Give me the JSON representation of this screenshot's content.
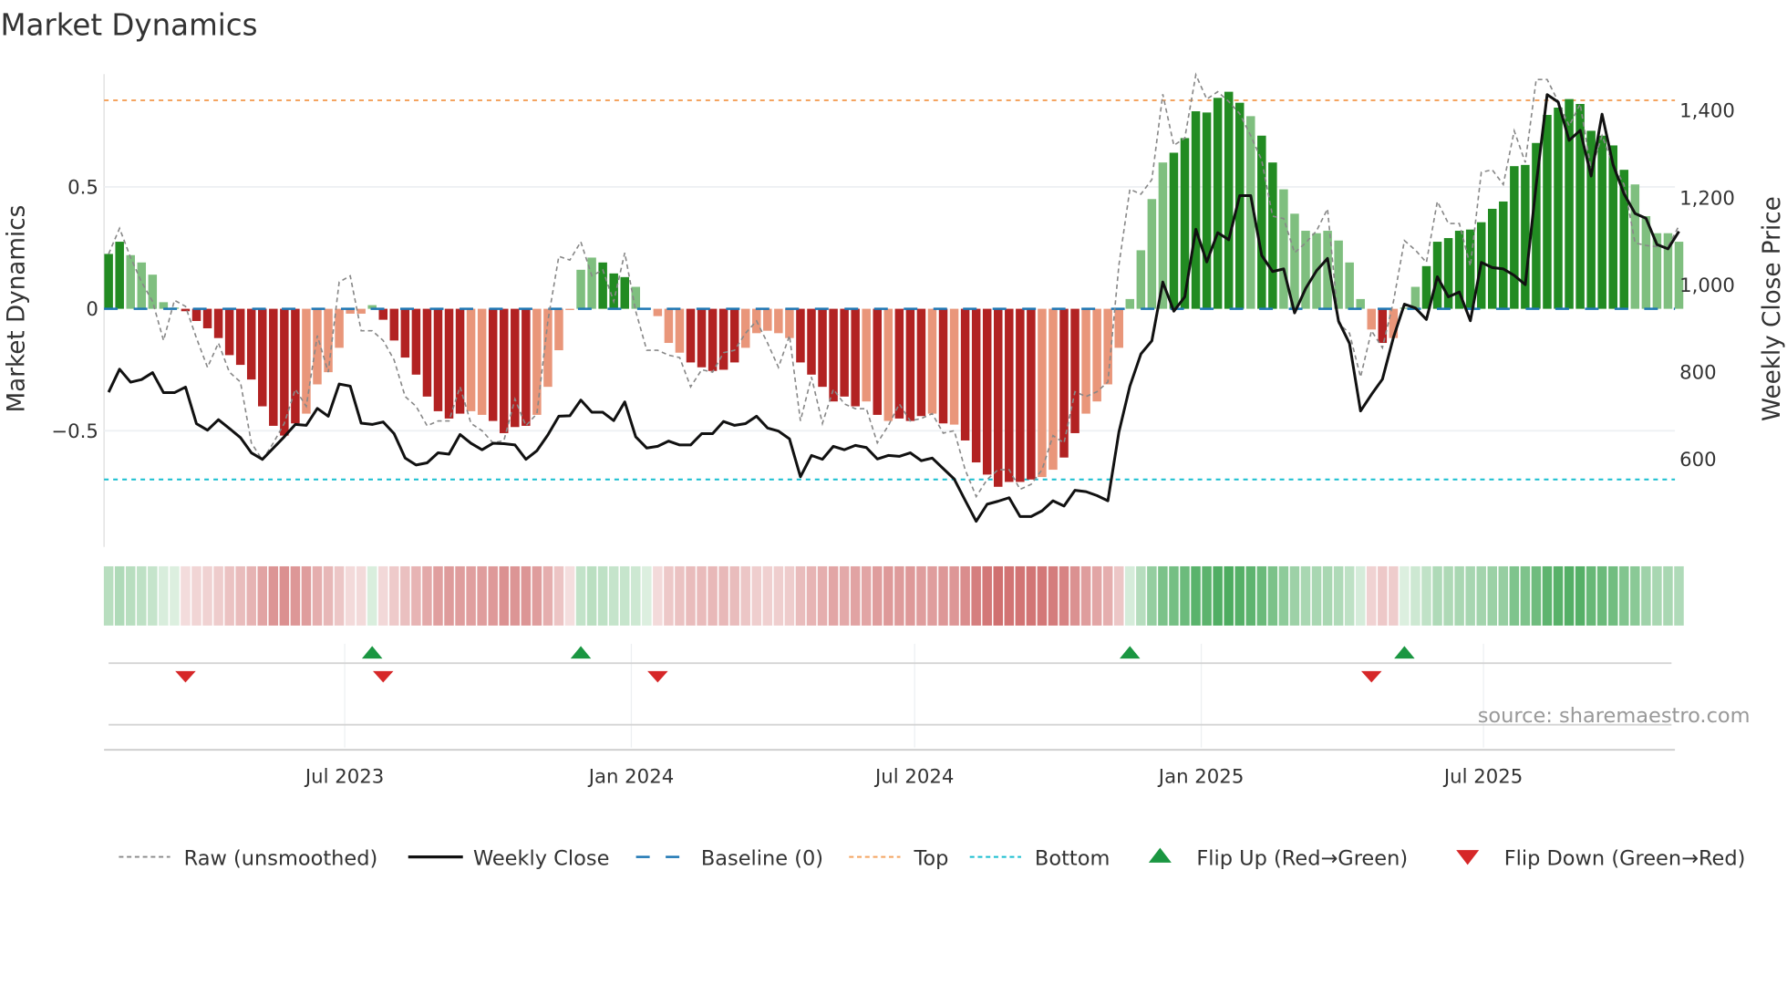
{
  "chart_data": {
    "type": "bar",
    "title": "Market Dynamics",
    "ylabel": "Market Dynamics",
    "y2label": "Weekly Close Price",
    "source": "source: sharemaestro.com",
    "ylim": [
      -0.98,
      0.96
    ],
    "y2lim": [
      420,
      1485
    ],
    "yticks": [
      {
        "v": 0.5,
        "label": "0.5"
      },
      {
        "v": 0,
        "label": "0"
      },
      {
        "v": -0.5,
        "label": "−0.5"
      }
    ],
    "y2ticks": [
      {
        "v": 1400,
        "label": "1,400"
      },
      {
        "v": 1200,
        "label": "1,200"
      },
      {
        "v": 1000,
        "label": "1,000"
      },
      {
        "v": 800,
        "label": "800"
      },
      {
        "v": 600,
        "label": "600"
      }
    ],
    "xticks": [
      {
        "week": 21.5,
        "label": "Jul 2023"
      },
      {
        "week": 47.6,
        "label": "Jan 2024"
      },
      {
        "week": 73.4,
        "label": "Jul 2024"
      },
      {
        "week": 99.5,
        "label": "Jan 2025"
      },
      {
        "week": 125.2,
        "label": "Jul 2025"
      }
    ],
    "top_level": 0.855,
    "bottom_level": -0.7,
    "baseline": 0,
    "momentum": [
      0.225,
      0.275,
      0.22,
      0.19,
      0.14,
      0.027,
      0.005,
      -0.01,
      -0.05,
      -0.08,
      -0.12,
      -0.19,
      -0.23,
      -0.29,
      -0.4,
      -0.48,
      -0.52,
      -0.47,
      -0.43,
      -0.31,
      -0.26,
      -0.16,
      -0.02,
      -0.02,
      0.015,
      -0.045,
      -0.13,
      -0.2,
      -0.27,
      -0.36,
      -0.42,
      -0.45,
      -0.43,
      -0.42,
      -0.435,
      -0.46,
      -0.51,
      -0.485,
      -0.48,
      -0.435,
      -0.32,
      -0.17,
      -0.005,
      0.16,
      0.21,
      0.19,
      0.145,
      0.13,
      0.09,
      0.003,
      -0.03,
      -0.14,
      -0.18,
      -0.22,
      -0.24,
      -0.255,
      -0.25,
      -0.22,
      -0.16,
      -0.1,
      -0.09,
      -0.1,
      -0.12,
      -0.22,
      -0.27,
      -0.32,
      -0.38,
      -0.36,
      -0.4,
      -0.38,
      -0.435,
      -0.46,
      -0.45,
      -0.46,
      -0.44,
      -0.43,
      -0.47,
      -0.475,
      -0.54,
      -0.63,
      -0.68,
      -0.73,
      -0.71,
      -0.71,
      -0.7,
      -0.69,
      -0.66,
      -0.61,
      -0.51,
      -0.43,
      -0.38,
      -0.31,
      -0.16,
      0.04,
      0.24,
      0.45,
      0.6,
      0.64,
      0.7,
      0.81,
      0.805,
      0.865,
      0.89,
      0.845,
      0.79,
      0.71,
      0.6,
      0.49,
      0.39,
      0.32,
      0.31,
      0.32,
      0.28,
      0.19,
      0.04,
      -0.085,
      -0.14,
      -0.12,
      0.005,
      0.09,
      0.175,
      0.275,
      0.29,
      0.32,
      0.325,
      0.355,
      0.41,
      0.44,
      0.585,
      0.59,
      0.68,
      0.795,
      0.825,
      0.86,
      0.84,
      0.73,
      0.71,
      0.67,
      0.57,
      0.51,
      0.38,
      0.31,
      0.31,
      0.275
    ],
    "bar_tone": "ddllllldddddddddddlllllllddddddddllddddlllllldddllllldddddlllllddddddldldddldldddddddllddlllllllldddddddlddllllllllldllldddgdddddddddddddddllllllllld",
    "raw": [
      0.225,
      0.33,
      0.21,
      0.11,
      0.03,
      -0.13,
      0.035,
      0.01,
      -0.12,
      -0.24,
      -0.14,
      -0.26,
      -0.3,
      -0.55,
      -0.62,
      -0.55,
      -0.47,
      -0.33,
      -0.4,
      -0.11,
      -0.26,
      0.11,
      0.135,
      -0.09,
      -0.09,
      -0.13,
      -0.21,
      -0.36,
      -0.4,
      -0.48,
      -0.46,
      -0.46,
      -0.32,
      -0.47,
      -0.5,
      -0.55,
      -0.54,
      -0.37,
      -0.48,
      -0.43,
      -0.05,
      0.215,
      0.2,
      0.275,
      0.135,
      0.16,
      0.03,
      0.23,
      -0.01,
      -0.17,
      -0.17,
      -0.19,
      -0.2,
      -0.32,
      -0.25,
      -0.26,
      -0.18,
      -0.17,
      -0.1,
      -0.05,
      -0.14,
      -0.24,
      -0.11,
      -0.46,
      -0.28,
      -0.47,
      -0.33,
      -0.39,
      -0.41,
      -0.41,
      -0.55,
      -0.48,
      -0.39,
      -0.46,
      -0.45,
      -0.43,
      -0.51,
      -0.5,
      -0.66,
      -0.77,
      -0.7,
      -0.66,
      -0.66,
      -0.74,
      -0.72,
      -0.66,
      -0.52,
      -0.55,
      -0.34,
      -0.36,
      -0.34,
      -0.3,
      0.18,
      0.49,
      0.47,
      0.53,
      0.88,
      0.67,
      0.7,
      0.96,
      0.86,
      0.89,
      0.85,
      0.8,
      0.71,
      0.61,
      0.38,
      0.37,
      0.23,
      0.27,
      0.32,
      0.41,
      -0.06,
      -0.1,
      -0.28,
      -0.09,
      -0.16,
      0.03,
      0.28,
      0.24,
      0.19,
      0.44,
      0.35,
      0.35,
      0.175,
      0.56,
      0.57,
      0.51,
      0.73,
      0.6,
      0.94,
      0.94,
      0.85,
      0.75,
      0.84,
      0.57,
      0.71,
      0.59,
      0.51,
      0.27,
      0.26,
      0.255,
      0.255,
      0.34
    ],
    "close": [
      751,
      804,
      774,
      780,
      796,
      750,
      750,
      763,
      679,
      664,
      688,
      668,
      647,
      612,
      597,
      623,
      649,
      677,
      675,
      714,
      696,
      770,
      765,
      680,
      677,
      683,
      656,
      600,
      584,
      589,
      612,
      609,
      654,
      634,
      619,
      634,
      633,
      630,
      597,
      617,
      653,
      696,
      697,
      733,
      705,
      705,
      686,
      729,
      649,
      623,
      627,
      639,
      630,
      630,
      656,
      656,
      684,
      675,
      679,
      696,
      669,
      662,
      644,
      557,
      606,
      597,
      627,
      619,
      629,
      624,
      598,
      606,
      604,
      612,
      594,
      600,
      576,
      552,
      503,
      455,
      494,
      501,
      509,
      466,
      466,
      479,
      502,
      490,
      526,
      523,
      514,
      502,
      660,
      765,
      839,
      869,
      1004,
      937,
      970,
      1125,
      1050,
      1117,
      1101,
      1202,
      1202,
      1065,
      1028,
      1034,
      933,
      989,
      1030,
      1058,
      914,
      863,
      708,
      746,
      781,
      877,
      953,
      944,
      918,
      1016,
      970,
      981,
      915,
      1049,
      1037,
      1034,
      1019,
      998,
      1228,
      1434,
      1417,
      1329,
      1352,
      1247,
      1389,
      1273,
      1206,
      1161,
      1150,
      1090,
      1080,
      1120
    ],
    "flip_up_weeks": [
      24,
      43,
      93,
      118
    ],
    "flip_down_weeks": [
      7,
      25,
      50,
      115
    ],
    "legend": [
      {
        "key": "raw",
        "label": "Raw (unsmoothed)"
      },
      {
        "key": "close",
        "label": "Weekly Close"
      },
      {
        "key": "baseline",
        "label": "Baseline (0)"
      },
      {
        "key": "top",
        "label": "Top"
      },
      {
        "key": "bottom",
        "label": "Bottom"
      },
      {
        "key": "up",
        "label": "Flip Up (Red→Green)"
      },
      {
        "key": "down",
        "label": "Flip Down (Green→Red)"
      }
    ],
    "colors": {
      "dark_green": "#228b22",
      "light_green": "#7fbf7f",
      "dark_red": "#b22222",
      "light_red": "#e9967a",
      "close": "#111111",
      "raw": "#888888",
      "baseline": "#1f77b4",
      "top": "#f4a460",
      "bottom": "#17becf",
      "flip_up": "#1a9641",
      "flip_down": "#d62728"
    }
  }
}
